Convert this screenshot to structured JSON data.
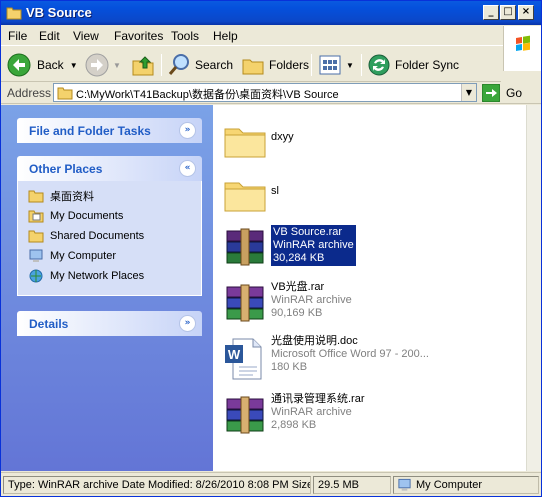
{
  "window": {
    "title": "VB Source"
  },
  "menu": [
    "File",
    "Edit",
    "View",
    "Favorites",
    "Tools",
    "Help"
  ],
  "toolbar": {
    "back": "Back",
    "search": "Search",
    "folders": "Folders",
    "folder_sync": "Folder Sync"
  },
  "address": {
    "label": "Address",
    "value": "C:\\MyWork\\T41Backup\\数据备份\\桌面资料\\VB Source",
    "go": "Go"
  },
  "taskpane": {
    "file_tasks": "File and Folder Tasks",
    "other_places": "Other Places",
    "places": [
      "桌面资料",
      "My Documents",
      "Shared Documents",
      "My Computer",
      "My Network Places"
    ],
    "details": "Details"
  },
  "files": [
    {
      "name": "dxyy",
      "type": "",
      "size": "",
      "icon": "folder-icon"
    },
    {
      "name": "sl",
      "type": "",
      "size": "",
      "icon": "folder-icon"
    },
    {
      "name": "VB Source.rar",
      "type": "WinRAR archive",
      "size": "30,284 KB",
      "icon": "winrar-icon",
      "selected": true
    },
    {
      "name": "VB光盘.rar",
      "type": "WinRAR archive",
      "size": "90,169 KB",
      "icon": "winrar-icon"
    },
    {
      "name": "光盘使用说明.doc",
      "type": "Microsoft Office Word 97 - 200...",
      "size": "180 KB",
      "icon": "word-doc-icon"
    },
    {
      "name": "通讯录管理系统.rar",
      "type": "WinRAR archive",
      "size": "2,898 KB",
      "icon": "winrar-icon"
    }
  ],
  "status": {
    "info": "Type: WinRAR archive Date Modified: 8/26/2010 8:08 PM Size",
    "size": "29.5 MB",
    "location": "My Computer"
  },
  "colors": {
    "titlebar": "#0a5ae0",
    "taskpane": "#6375d6",
    "selection": "#0b2a8c"
  }
}
